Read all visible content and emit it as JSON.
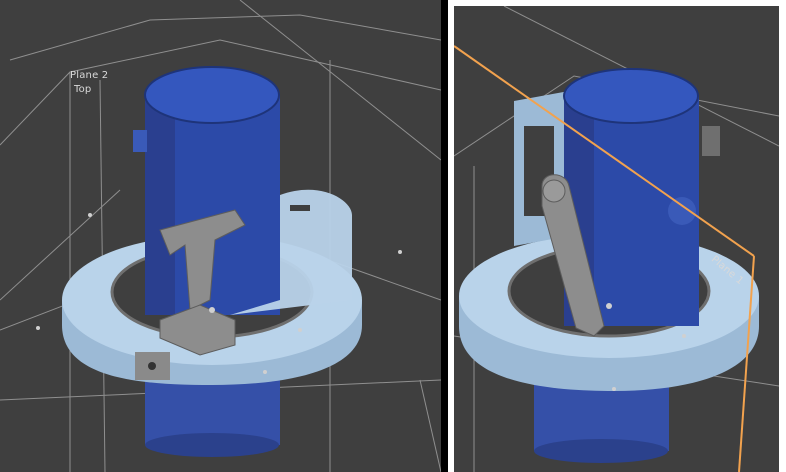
{
  "left_view": {
    "plane_labels": {
      "plane2": "Plane 2",
      "top": "Top"
    }
  },
  "right_view": {
    "plane_labels": {
      "plane1": "Plane 1"
    }
  },
  "colors": {
    "background": "#3f3f3f",
    "part_light_blue": "#b9d3ea",
    "cylinder_blue": "#2c4aa8",
    "bracket_gray": "#8a8a8a",
    "plane_orange": "#f2a24e",
    "frame_white": "#ffffff"
  }
}
